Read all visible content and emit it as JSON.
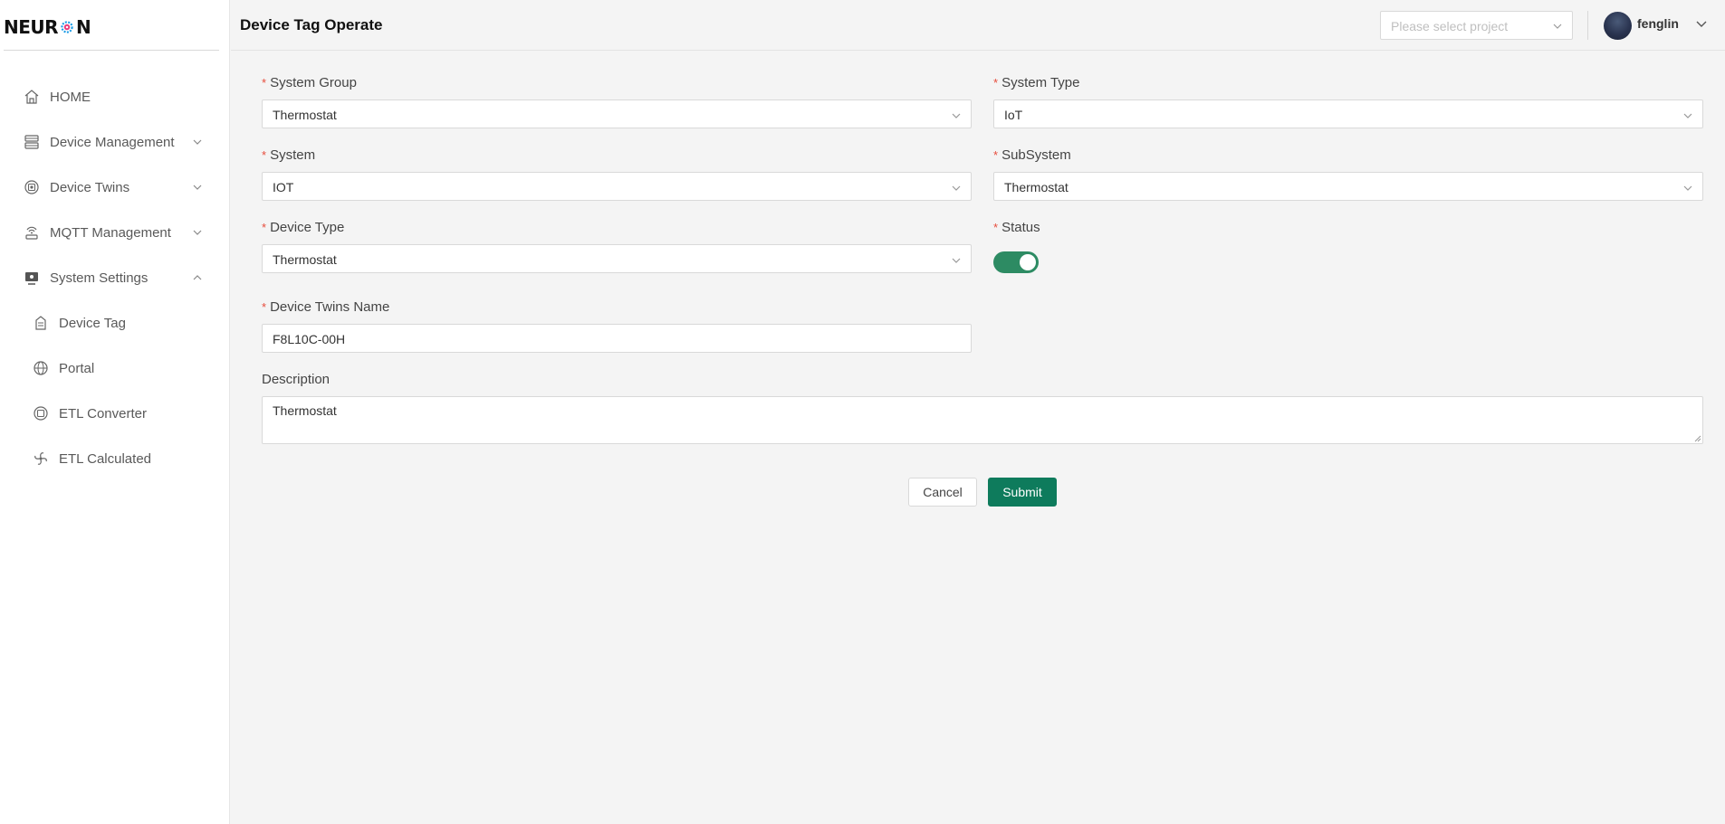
{
  "app": {
    "logo_text_left": "NEUR",
    "logo_text_right": "N"
  },
  "sidebar": {
    "items": [
      {
        "label": "HOME",
        "icon": "home-icon"
      },
      {
        "label": "Device Management",
        "icon": "server-icon"
      },
      {
        "label": "Device Twins",
        "icon": "twins-icon"
      },
      {
        "label": "MQTT Management",
        "icon": "broadcast-icon"
      },
      {
        "label": "System Settings",
        "icon": "monitor-icon"
      }
    ],
    "sub_items": [
      {
        "label": "Device Tag",
        "icon": "tag-building-icon"
      },
      {
        "label": "Portal",
        "icon": "globe-icon"
      },
      {
        "label": "ETL Converter",
        "icon": "converter-icon"
      },
      {
        "label": "ETL Calculated",
        "icon": "fan-icon"
      }
    ]
  },
  "header": {
    "title": "Device Tag Operate",
    "project_placeholder": "Please select project",
    "username": "fenglin"
  },
  "form": {
    "system_group": {
      "label": "System Group",
      "value": "Thermostat"
    },
    "system_type": {
      "label": "System Type",
      "value": "IoT"
    },
    "system": {
      "label": "System",
      "value": "IOT"
    },
    "subsystem": {
      "label": "SubSystem",
      "value": "Thermostat"
    },
    "device_type": {
      "label": "Device Type",
      "value": "Thermostat"
    },
    "status": {
      "label": "Status",
      "on": true
    },
    "device_twins_name": {
      "label": "Device Twins Name",
      "value": "F8L10C-00H"
    },
    "description": {
      "label": "Description",
      "value": "Thermostat"
    },
    "required_mark": "*"
  },
  "actions": {
    "cancel": "Cancel",
    "submit": "Submit"
  },
  "colors": {
    "accent": "#0e7b5c",
    "toggle_on": "#2d8b63",
    "required": "#e74c3c"
  }
}
